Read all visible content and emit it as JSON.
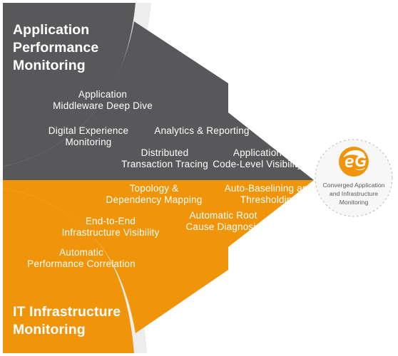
{
  "diagram": {
    "title": "Converged Application and Infrastructure Monitoring",
    "colors": {
      "gray": "#58585a",
      "orange": "#f09409",
      "shadow": "#ededed",
      "white": "#ffffff",
      "badge_fill": "#f7f7f7",
      "badge_border": "#bfbfbf"
    },
    "top_arrow": {
      "heading": "Application\nPerformance\nMonitoring",
      "items": [
        {
          "label": "Application\nMiddleware Deep Dive"
        },
        {
          "label": "Digital Experience\nMonitoring"
        },
        {
          "label": "Analytics & Reporting"
        },
        {
          "label": "Distributed\nTransaction Tracing"
        },
        {
          "label": "Application\nCode-Level Visibility"
        }
      ]
    },
    "bottom_arrow": {
      "heading": "IT Infrastructure\nMonitoring",
      "items": [
        {
          "label": "Topology &\nDependency Mapping"
        },
        {
          "label": "Auto-Baselining and\nThresholding"
        },
        {
          "label": "End-to-End\nInfrastructure Visibility"
        },
        {
          "label": "Automatic Root\nCause Diagnosis"
        },
        {
          "label": "Automatic\nPerformance Correlation"
        }
      ]
    },
    "badge": {
      "logo_name": "eg-logo-icon",
      "logo_text": "eG",
      "caption": "Converged Application\nand Infrastructure\nMonitoring"
    }
  }
}
